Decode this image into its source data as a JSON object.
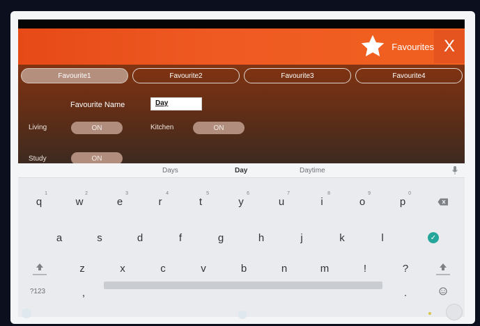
{
  "header": {
    "title": "Favourites",
    "close_label": "X",
    "star_icon": "star-icon",
    "accent": "#e64a17"
  },
  "tabs": [
    {
      "label": "Favourite1",
      "active": true
    },
    {
      "label": "Favourite2",
      "active": false
    },
    {
      "label": "Favourite3",
      "active": false
    },
    {
      "label": "Favourite4",
      "active": false
    }
  ],
  "form": {
    "name_label": "Favourite Name",
    "name_value": "Day",
    "rooms": [
      {
        "label": "Living",
        "state": "ON"
      },
      {
        "label": "Kitchen",
        "state": "ON"
      },
      {
        "label": "Study",
        "state": "ON"
      }
    ]
  },
  "keyboard": {
    "suggestions": [
      "Days",
      "Day",
      "Daytime"
    ],
    "row1": [
      {
        "key": "q",
        "hint": "1"
      },
      {
        "key": "w",
        "hint": "2"
      },
      {
        "key": "e",
        "hint": "3"
      },
      {
        "key": "r",
        "hint": "4"
      },
      {
        "key": "t",
        "hint": "5"
      },
      {
        "key": "y",
        "hint": "6"
      },
      {
        "key": "u",
        "hint": "7"
      },
      {
        "key": "i",
        "hint": "8"
      },
      {
        "key": "o",
        "hint": "9"
      },
      {
        "key": "p",
        "hint": "0"
      }
    ],
    "row2": [
      "a",
      "s",
      "d",
      "f",
      "g",
      "h",
      "j",
      "k",
      "l"
    ],
    "row3": [
      "z",
      "x",
      "c",
      "v",
      "b",
      "n",
      "m",
      "!",
      "?"
    ],
    "symbols_label": "?123",
    "comma": ",",
    "period": ".",
    "icons": {
      "backspace": "backspace-icon",
      "enter": "enter-check-icon",
      "shift": "shift-icon",
      "emoji": "emoji-icon",
      "mic": "microphone-icon"
    }
  }
}
